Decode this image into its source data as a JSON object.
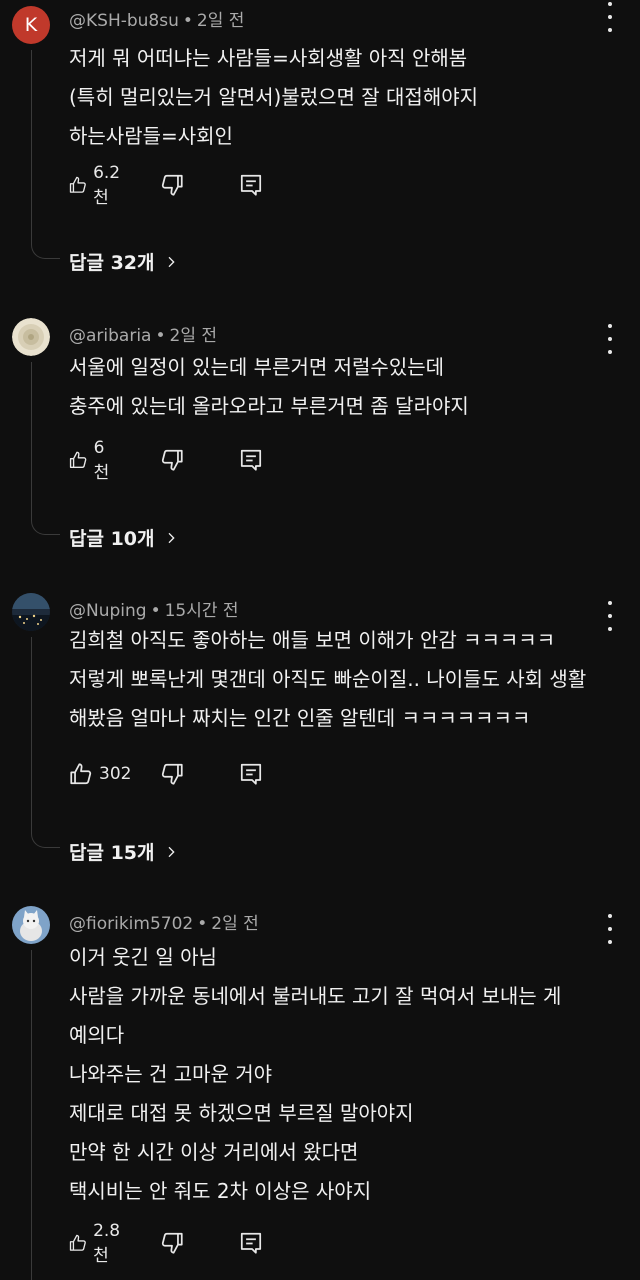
{
  "comments": [
    {
      "avatar_letter": "K",
      "avatar_color": "#c0392b",
      "author": "@KSH-bu8su",
      "time": "2일 전",
      "lines": [
        "저게 뭐 어떠냐는 사람들=사회생활 아직 안해봄",
        "(특히 멀리있는거 알면서)불렀으면 잘 대접해야지",
        "하는사람들=사회인"
      ],
      "likes": "6.2천",
      "replies": "답글 32개"
    },
    {
      "avatar_icon": "shell-avatar-icon",
      "author": "@aribaria",
      "time": "2일 전",
      "lines": [
        "서울에 일정이 있는데 부른거면 저럴수있는데",
        "충주에 있는데 올라오라고 부른거면 좀 달라야지"
      ],
      "likes": "6천",
      "replies": "답글 10개"
    },
    {
      "avatar_icon": "night-city-avatar-icon",
      "author": "@Nuping",
      "time": "15시간 전",
      "lines": [
        "김희철 아직도 좋아하는 애들 보면 이해가 안감 ㅋㅋㅋㅋㅋ",
        "저렇게 뽀록난게 몇갠데 아직도 빠순이질.. 나이들도 사회 생활",
        "해봤음 얼마나 짜치는 인간 인줄 알텐데 ㅋㅋㅋㅋㅋㅋㅋ"
      ],
      "likes": "302",
      "replies": "답글 15개"
    },
    {
      "avatar_icon": "cat-avatar-icon",
      "author": "@fiorikim5702",
      "time": "2일 전",
      "lines": [
        "이거 웃긴 일 아님",
        "사람을 가까운 동네에서 불러내도 고기 잘 먹여서 보내는 게",
        "예의다",
        "나와주는 건 고마운 거야",
        "제대로 대접 못 하겠으면 부르질 말아야지",
        "만약 한 시간 이상 거리에서 왔다면",
        "택시비는 안 줘도 2차 이상은 사야지"
      ],
      "likes": "2.8천"
    }
  ],
  "separator": "•"
}
